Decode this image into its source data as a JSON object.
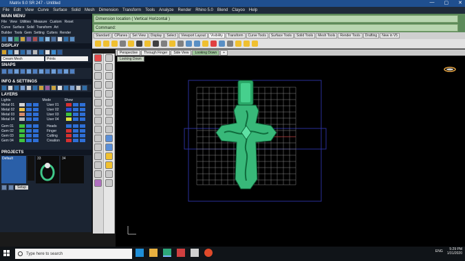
{
  "window": {
    "title": "Matrix 9.0 SR 247 - Untitled",
    "controls": [
      "—",
      "▢",
      "✕"
    ]
  },
  "menu": [
    "File",
    "Edit",
    "View",
    "Curve",
    "Surface",
    "Solid",
    "Mesh",
    "Dimension",
    "Transform",
    "Tools",
    "Analyze",
    "Render",
    "Rhino 5.0",
    "Blend",
    "Clayoo",
    "Help"
  ],
  "left_panel": {
    "main_menu_title": "MAIN MENU",
    "main_menu_items": [
      "File",
      "View",
      "Utilities",
      "Measure",
      "Custom",
      "Reset"
    ],
    "builder_row": [
      "Curve",
      "Surface",
      "Solid",
      "Transform",
      "Art"
    ],
    "builder_row2": [
      "Builder",
      "Tools",
      "Gem",
      "Setting",
      "Cutters",
      "Render"
    ],
    "display_title": "DISPLAY",
    "display_field1": "Cream Mesh",
    "display_field2": "Prints",
    "snaps_title": "SNAPS",
    "info_title": "INFO & SETTINGS",
    "layers_title": "LAYERS",
    "layers_header": [
      "Lights",
      "Mode",
      "Show"
    ],
    "layers_left": [
      "Metal 01",
      "Metal 02",
      "Metal 03",
      "Metal 04",
      "Gem 01",
      "Gem 02",
      "Gem 03",
      "Gem 04"
    ],
    "layers_right": [
      "User 01",
      "User 02",
      "User 03",
      "User 04",
      "Heads",
      "Finger",
      "Cutting",
      "Creation"
    ],
    "projects_title": "PROJECTS",
    "projects_default": "Default",
    "project_num1": "33",
    "project_num2": "34",
    "projects_btn": "Setup"
  },
  "command": {
    "line1": "Dimension location ( Vertical  Horizontal )",
    "line2": "Command:"
  },
  "toolbar_tabs": [
    "Standard",
    "CPlanes",
    "Set View",
    "Display",
    "Select",
    "Viewport Layout",
    "Visibility",
    "Transform",
    "Curve Tools",
    "Surface Tools",
    "Solid Tools",
    "Mesh Tools",
    "Render Tools",
    "Drafting",
    "New in V5"
  ],
  "toolbar_active_tab": "Visibility",
  "viewport_tabs": [
    "Perspective",
    "Through Finger",
    "Side View",
    "Looking Down",
    "+"
  ],
  "viewport_active": "Looking Down",
  "viewport_label": "Looking Down",
  "taskbar": {
    "search_placeholder": "Type here to search",
    "lang": "ENG",
    "time": "5:29 PM",
    "date": "1/31/2020"
  },
  "colors": {
    "accent_green": "#3fc98a",
    "grid": "#8a8a8a",
    "bbox_blue": "#2a2f9a"
  }
}
